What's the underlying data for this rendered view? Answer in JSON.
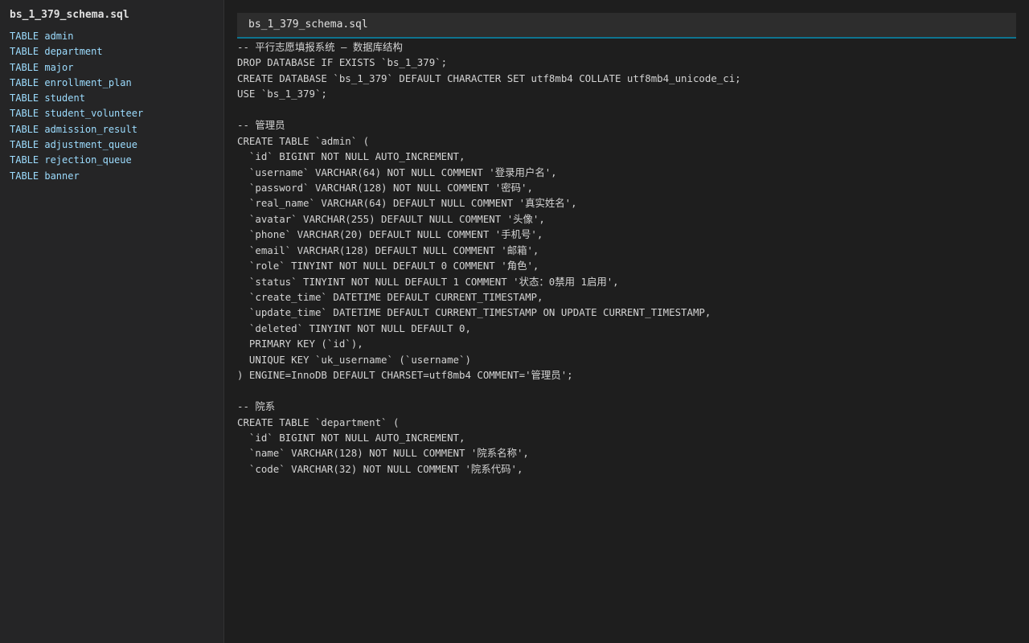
{
  "sidebar": {
    "title": "bs_1_379_schema.sql",
    "items": [
      {
        "label": "TABLE admin"
      },
      {
        "label": "TABLE department"
      },
      {
        "label": "TABLE major"
      },
      {
        "label": "TABLE enrollment_plan"
      },
      {
        "label": "TABLE student"
      },
      {
        "label": "TABLE student_volunteer"
      },
      {
        "label": "TABLE admission_result"
      },
      {
        "label": "TABLE adjustment_queue"
      },
      {
        "label": "TABLE rejection_queue"
      },
      {
        "label": "TABLE banner"
      }
    ]
  },
  "editor": {
    "tab_title": "bs_1_379_schema.sql",
    "lines": [
      "-- 平行志愿填报系统 — 数据库结构",
      "DROP DATABASE IF EXISTS `bs_1_379`;",
      "CREATE DATABASE `bs_1_379` DEFAULT CHARACTER SET utf8mb4 COLLATE utf8mb4_unicode_ci;",
      "USE `bs_1_379`;",
      "",
      "-- 管理员",
      "CREATE TABLE `admin` (",
      "  `id` BIGINT NOT NULL AUTO_INCREMENT,",
      "  `username` VARCHAR(64) NOT NULL COMMENT '登录用户名',",
      "  `password` VARCHAR(128) NOT NULL COMMENT '密码',",
      "  `real_name` VARCHAR(64) DEFAULT NULL COMMENT '真实姓名',",
      "  `avatar` VARCHAR(255) DEFAULT NULL COMMENT '头像',",
      "  `phone` VARCHAR(20) DEFAULT NULL COMMENT '手机号',",
      "  `email` VARCHAR(128) DEFAULT NULL COMMENT '邮箱',",
      "  `role` TINYINT NOT NULL DEFAULT 0 COMMENT '角色',",
      "  `status` TINYINT NOT NULL DEFAULT 1 COMMENT '状态：0禁用 1启用',",
      "  `create_time` DATETIME DEFAULT CURRENT_TIMESTAMP,",
      "  `update_time` DATETIME DEFAULT CURRENT_TIMESTAMP ON UPDATE CURRENT_TIMESTAMP,",
      "  `deleted` TINYINT NOT NULL DEFAULT 0,",
      "  PRIMARY KEY (`id`),",
      "  UNIQUE KEY `uk_username` (`username`)",
      ") ENGINE=InnoDB DEFAULT CHARSET=utf8mb4 COMMENT='管理员';",
      "",
      "-- 院系",
      "CREATE TABLE `department` (",
      "  `id` BIGINT NOT NULL AUTO_INCREMENT,",
      "  `name` VARCHAR(128) NOT NULL COMMENT '院系名称',",
      "  `code` VARCHAR(32) NOT NULL COMMENT '院系代码',"
    ]
  }
}
